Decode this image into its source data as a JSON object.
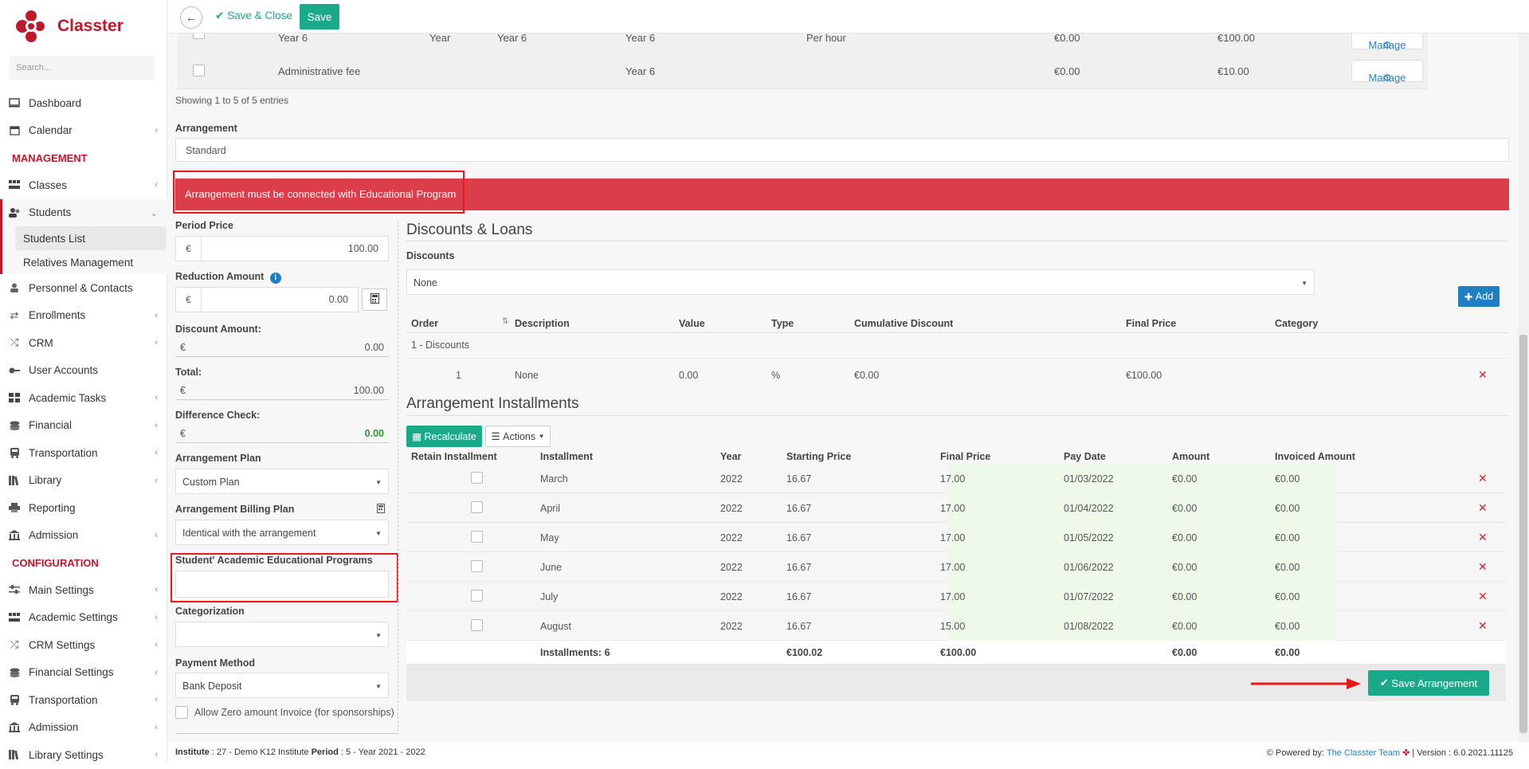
{
  "app": {
    "name": "Classter"
  },
  "colors": {
    "brand": "#c0182b",
    "accent_green": "#1aaa8a",
    "accent_blue": "#1e7fc3",
    "alert_red": "#dc3d4a",
    "callout": "#e8191a"
  },
  "sidebar": {
    "search_placeholder": "Search...",
    "items": [
      {
        "label": "Dashboard",
        "icon": "monitor-icon"
      },
      {
        "label": "Calendar",
        "icon": "calendar-icon"
      }
    ],
    "section_management": "MANAGEMENT",
    "mgmt_items": [
      {
        "label": "Classes",
        "icon": "classes-icon"
      },
      {
        "label": "Students",
        "icon": "users-icon"
      }
    ],
    "students_sub": [
      "Students List",
      "Relatives Management"
    ],
    "mgmt_items2": [
      {
        "label": "Personnel & Contacts",
        "icon": "person-icon"
      },
      {
        "label": "Enrollments",
        "icon": "exchange-icon"
      },
      {
        "label": "CRM",
        "icon": "shuffle-icon"
      },
      {
        "label": "User Accounts",
        "icon": "key-icon"
      },
      {
        "label": "Academic Tasks",
        "icon": "tasks-icon"
      },
      {
        "label": "Financial",
        "icon": "coins-icon"
      },
      {
        "label": "Transportation",
        "icon": "bus-icon"
      },
      {
        "label": "Library",
        "icon": "library-icon"
      },
      {
        "label": "Reporting",
        "icon": "printer-icon"
      },
      {
        "label": "Admission",
        "icon": "institution-icon"
      }
    ],
    "section_configuration": "CONFIGURATION",
    "config_items": [
      {
        "label": "Main Settings",
        "icon": "sliders-icon"
      },
      {
        "label": "Academic Settings",
        "icon": "classes-icon"
      },
      {
        "label": "CRM Settings",
        "icon": "shuffle-icon"
      },
      {
        "label": "Financial Settings",
        "icon": "coins-icon"
      },
      {
        "label": "Transportation",
        "icon": "bus-icon"
      },
      {
        "label": "Admission",
        "icon": "institution-icon"
      },
      {
        "label": "Library Settings",
        "icon": "library-icon"
      }
    ]
  },
  "toolbar": {
    "save_close": "Save & Close",
    "save": "Save"
  },
  "fees": [
    {
      "name": "Year 6",
      "year": "Year",
      "group": "Year 6",
      "program": "Year 6",
      "per": "Per hour",
      "price1": "€0.00",
      "price2": "€100.00",
      "manage": "Manage"
    },
    {
      "name": "Administrative fee",
      "year": "",
      "group": "",
      "program": "Year 6",
      "per": "",
      "price1": "€0.00",
      "price2": "€10.00",
      "manage": "Manage"
    }
  ],
  "showing": "Showing 1 to 5 of 5 entries",
  "arrangement": {
    "label": "Arrangement",
    "value": "Standard"
  },
  "alert": "Arrangement must be connected with Educational Program",
  "form": {
    "period_price_label": "Period Price",
    "period_price": "100.00",
    "reduction_label": "Reduction Amount",
    "reduction": "0.00",
    "discount_label": "Discount Amount:",
    "discount": "0.00",
    "total_label": "Total:",
    "total": "100.00",
    "diff_label": "Difference Check:",
    "diff": "0.00",
    "currency": "€",
    "plan_label": "Arrangement Plan",
    "plan": "Custom Plan",
    "billing_label": "Arrangement Billing Plan",
    "billing": "Identical with the arrangement",
    "programs_label": "Student' Academic Educational Programs",
    "categorization_label": "Categorization",
    "payment_label": "Payment Method",
    "payment": "Bank Deposit",
    "zero_invoice": "Allow Zero amount Invoice (for sponsorships)"
  },
  "discounts": {
    "title": "Discounts & Loans",
    "label": "Discounts",
    "select": "None",
    "add": "Add",
    "headers": [
      "Order",
      "Description",
      "Value",
      "Type",
      "Cumulative Discount",
      "Final Price",
      "Category"
    ],
    "group": "1 - Discounts",
    "row": {
      "order": "1",
      "description": "None",
      "value": "0.00",
      "type": "%",
      "cumulative": "€0.00",
      "final": "€100.00"
    }
  },
  "installments": {
    "title": "Arrangement Installments",
    "recalculate": "Recalculate",
    "actions": "Actions",
    "headers": [
      "Retain Installment",
      "Installment",
      "Year",
      "Starting Price",
      "Final Price",
      "Pay Date",
      "Amount",
      "Invoiced Amount"
    ],
    "rows": [
      {
        "month": "March",
        "year": "2022",
        "start": "16.67",
        "final": "17.00",
        "date": "01/03/2022",
        "amount": "€0.00",
        "invoiced": "€0.00"
      },
      {
        "month": "April",
        "year": "2022",
        "start": "16.67",
        "final": "17.00",
        "date": "01/04/2022",
        "amount": "€0.00",
        "invoiced": "€0.00"
      },
      {
        "month": "May",
        "year": "2022",
        "start": "16.67",
        "final": "17.00",
        "date": "01/05/2022",
        "amount": "€0.00",
        "invoiced": "€0.00"
      },
      {
        "month": "June",
        "year": "2022",
        "start": "16.67",
        "final": "17.00",
        "date": "01/06/2022",
        "amount": "€0.00",
        "invoiced": "€0.00"
      },
      {
        "month": "July",
        "year": "2022",
        "start": "16.67",
        "final": "17.00",
        "date": "01/07/2022",
        "amount": "€0.00",
        "invoiced": "€0.00"
      },
      {
        "month": "August",
        "year": "2022",
        "start": "16.67",
        "final": "15.00",
        "date": "01/08/2022",
        "amount": "€0.00",
        "invoiced": "€0.00"
      }
    ],
    "totals": {
      "label": "Installments: 6",
      "start": "€100.02",
      "final": "€100.00",
      "amount": "€0.00",
      "invoiced": "€0.00"
    },
    "save": "Save Arrangement"
  },
  "footer": {
    "institute_label": "Institute",
    "institute": ": 27 - Demo K12 Institute",
    "period_label": "Period",
    "period": ": 5 - Year 2021 - 2022",
    "powered": "Powered by:",
    "team": "The Classter Team",
    "version": "| Version : 6.0.2021.11125"
  }
}
